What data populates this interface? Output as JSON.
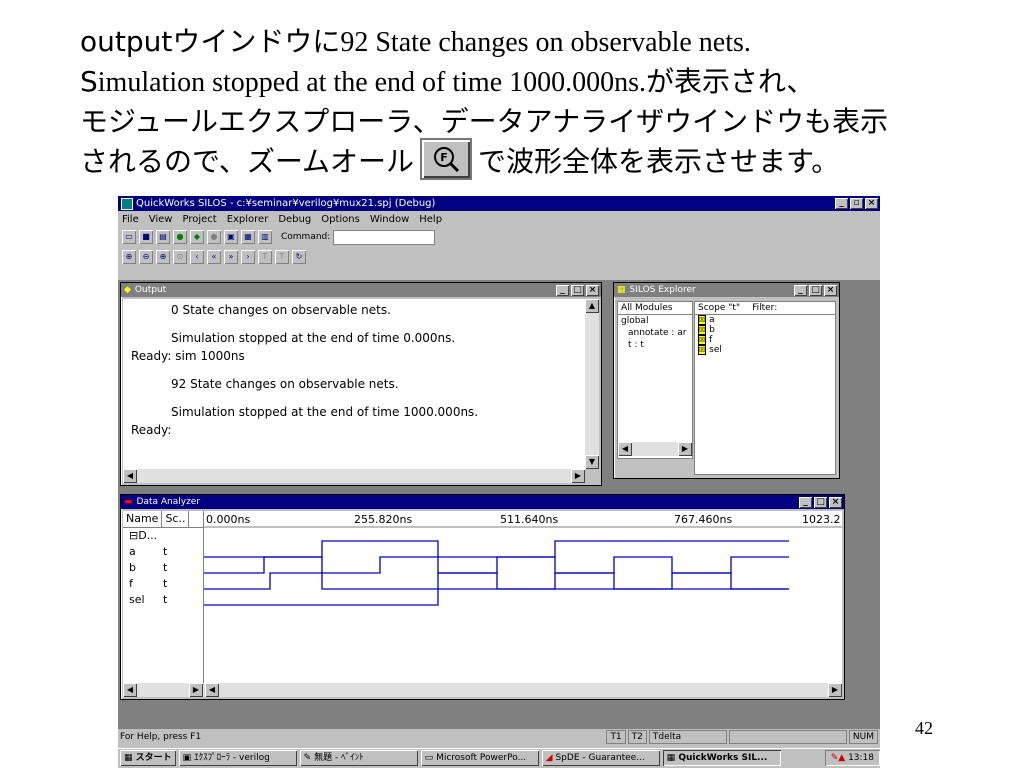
{
  "slide": {
    "line1_a": "outputウインドウに",
    "line1_b": "92 State changes on observable nets.",
    "line2_a": "S",
    "line2_b": "imulation stopped at the end of time 1000.000ns.",
    "line2_c": "が表示され、",
    "line3": "モジュールエクスプローラ、データアナライザウインドウも表示",
    "line4_a": "されるので、ズームオール",
    "line4_b": "で波形全体を表示させます。",
    "page_number": "42"
  },
  "window": {
    "title": "QuickWorks SILOS - c:¥seminar¥verilog¥mux21.spj (Debug)",
    "menu": [
      "File",
      "View",
      "Project",
      "Explorer",
      "Debug",
      "Options",
      "Window",
      "Help"
    ],
    "command_label": "Command:",
    "command_value": ""
  },
  "output": {
    "title": "Output",
    "lines": [
      "0 State changes on observable nets.",
      "Simulation stopped at the end of time 0.000ns.",
      "Ready: sim 1000ns",
      "92 State changes on observable nets.",
      "Simulation stopped at the end of time 1000.000ns.",
      "Ready:"
    ]
  },
  "explorer": {
    "title": "SILOS Explorer",
    "modules_header": "All Modules",
    "tree": [
      "global",
      "annotate : ar",
      "t : t"
    ],
    "scope_header": "Scope \"t\"",
    "filter_label": "Filter:",
    "signals": [
      "a",
      "b",
      "f",
      "sel"
    ]
  },
  "analyzer": {
    "title": "Data Analyzer",
    "col_name": "Name",
    "col_scope": "Sc..",
    "group": "D...",
    "time_ticks": [
      "0.000ns",
      "255.820ns",
      "511.640ns",
      "767.460ns",
      "1023.2"
    ],
    "rows": [
      {
        "name": "a",
        "scope": "t"
      },
      {
        "name": "b",
        "scope": "t"
      },
      {
        "name": "f",
        "scope": "t"
      },
      {
        "name": "sel",
        "scope": "t"
      }
    ]
  },
  "status": {
    "help": "For Help, press F1",
    "t1": "T1",
    "t2": "T2",
    "tdelta": "Tdelta",
    "num": "NUM"
  },
  "taskbar": {
    "start": "スタート",
    "tasks": [
      "ｴｸｽﾌﾟﾛｰﾗ - verilog",
      "無題 - ﾍﾟｲﾝﾄ",
      "Microsoft PowerPo...",
      "SpDE - Guarantee...",
      "QuickWorks SIL..."
    ],
    "clock": "13:18"
  },
  "colors": {
    "wave": "#0000c0",
    "titlebar": "#000080"
  }
}
